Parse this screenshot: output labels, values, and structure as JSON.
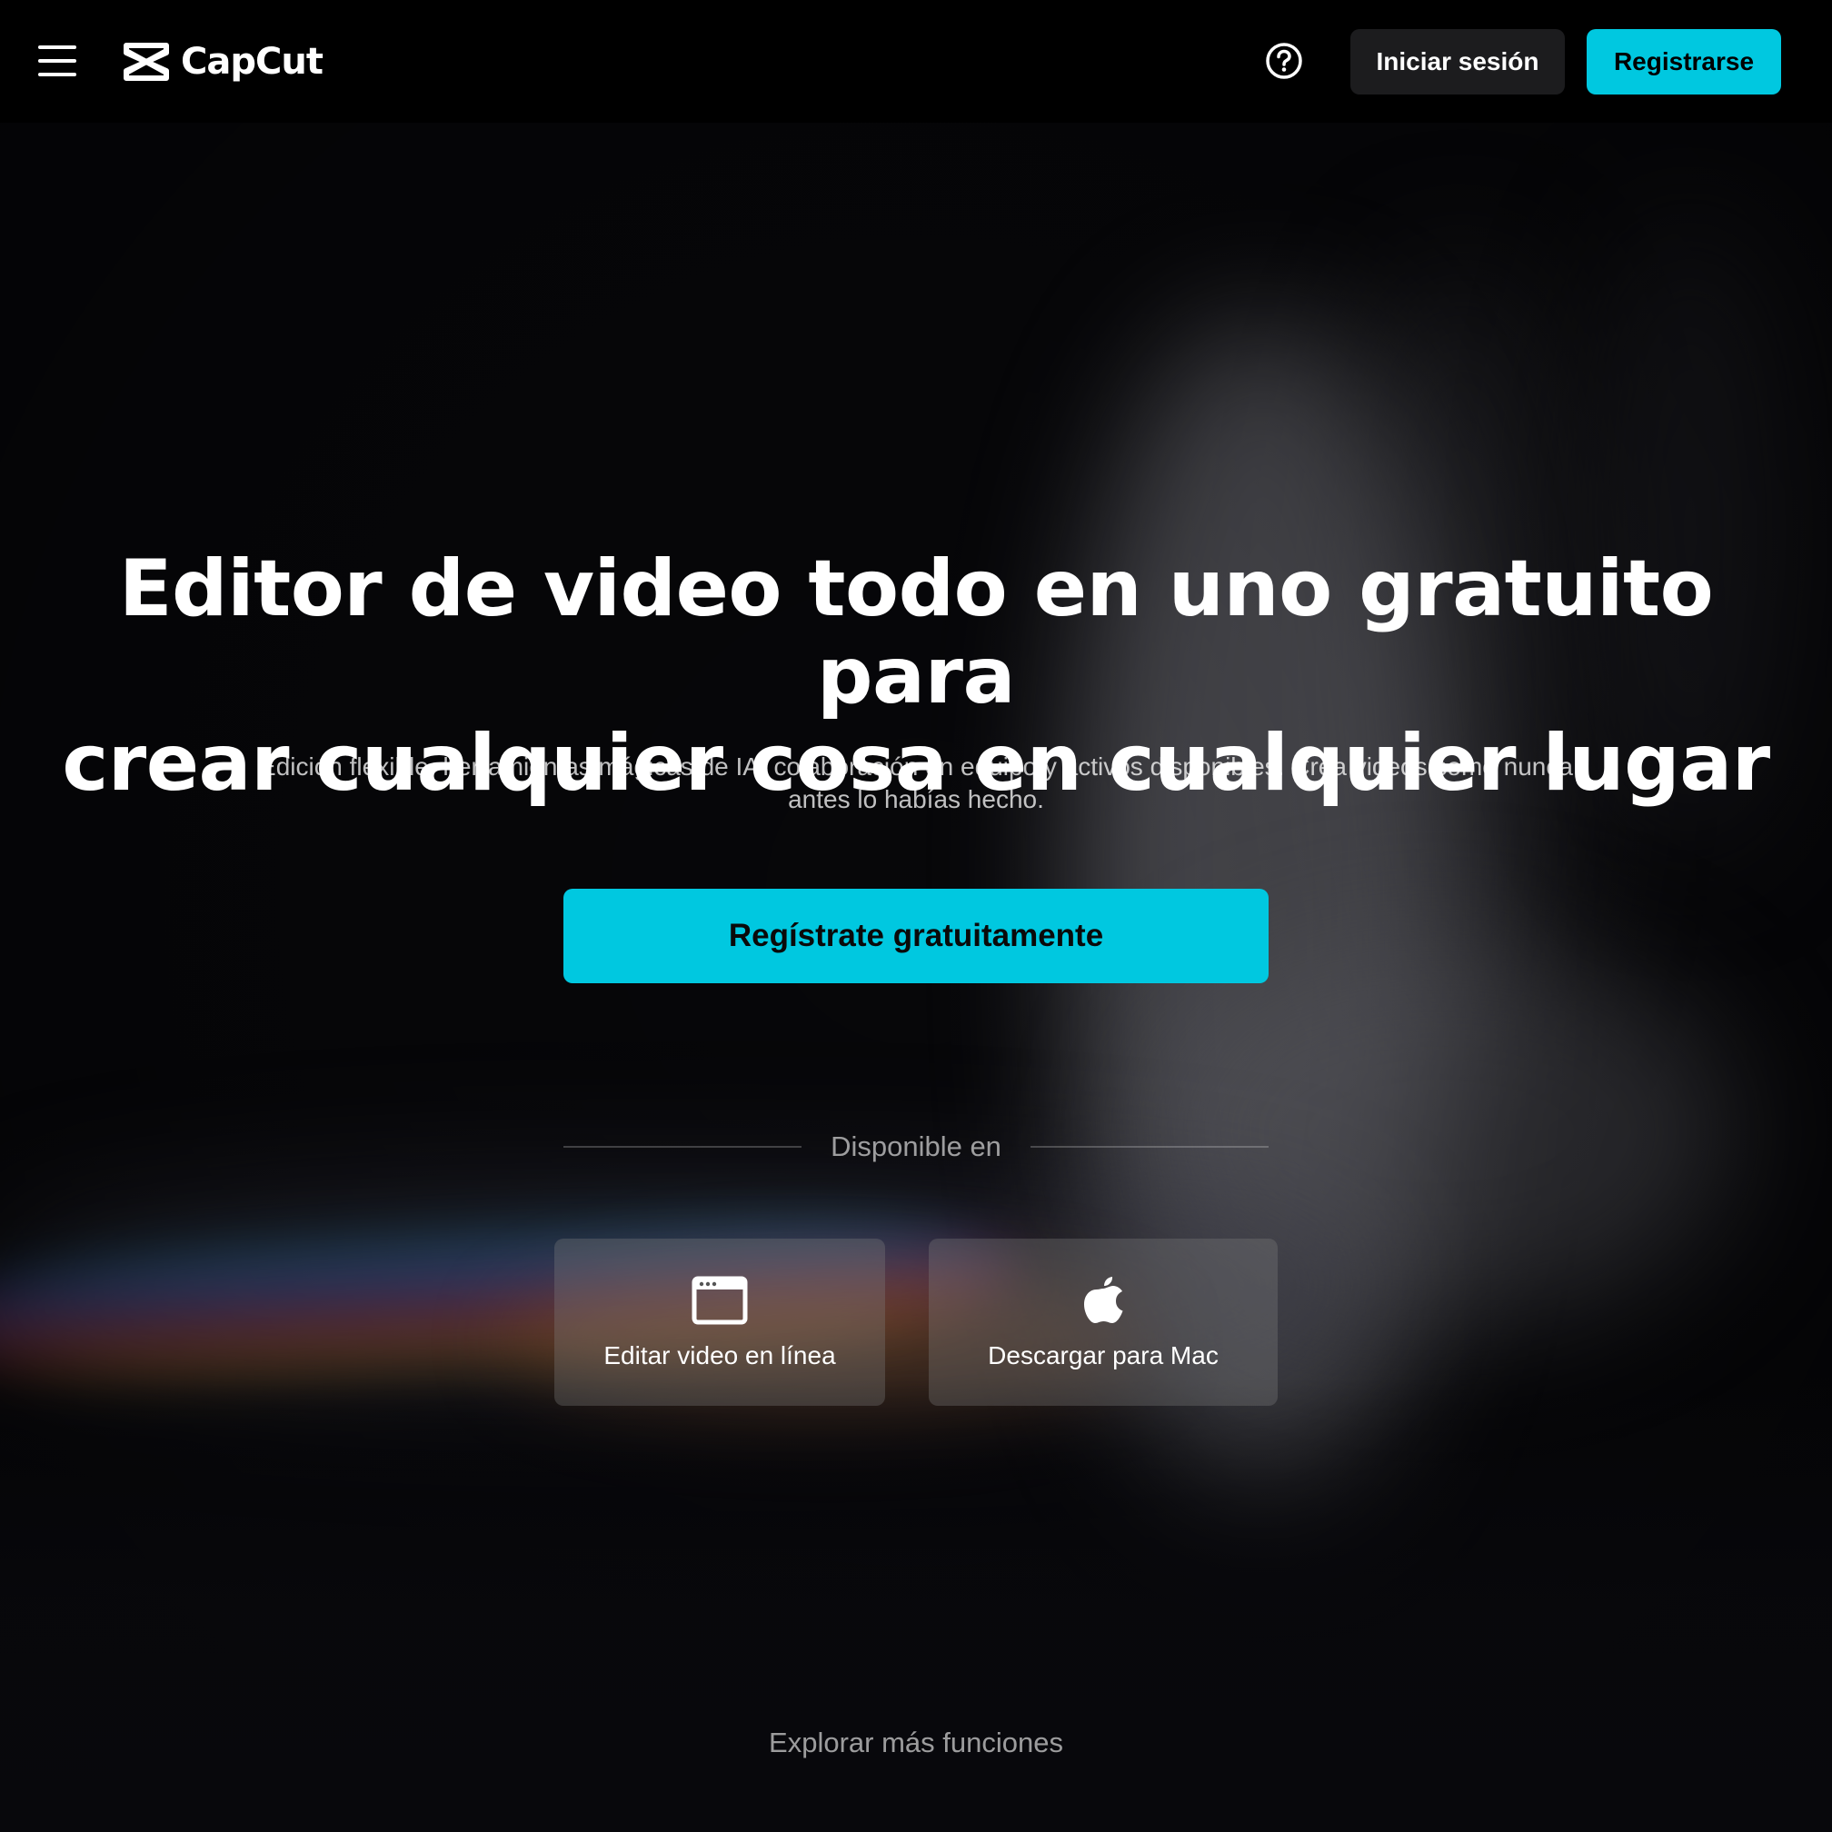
{
  "header": {
    "brand": "CapCut",
    "login_label": "Iniciar sesión",
    "register_label": "Registrarse",
    "icons": {
      "menu": "menu-icon",
      "logo": "capcut-logo-icon",
      "help": "help-icon"
    }
  },
  "hero": {
    "title_line1": "Editor de video todo en uno gratuito para",
    "title_line2": "crear cualquier cosa en cualquier lugar",
    "subtitle_line1": "Edición flexible, herramientas mágicas de IA, colaboración en equipo y activos disponibles. Crea videos como nunca",
    "subtitle_line2": "antes lo habías hecho.",
    "cta_label": "Regístrate gratuitamente"
  },
  "availability": {
    "label": "Disponible en",
    "platforms": [
      {
        "label": "Editar video en línea",
        "icon": "browser-window-icon"
      },
      {
        "label": "Descargar para Mac",
        "icon": "apple-icon"
      }
    ]
  },
  "footer": {
    "explore_label": "Explorar más funciones"
  },
  "colors": {
    "accent": "#00c8e0",
    "header_bg": "#000000",
    "login_bg": "#1c1c1e"
  }
}
